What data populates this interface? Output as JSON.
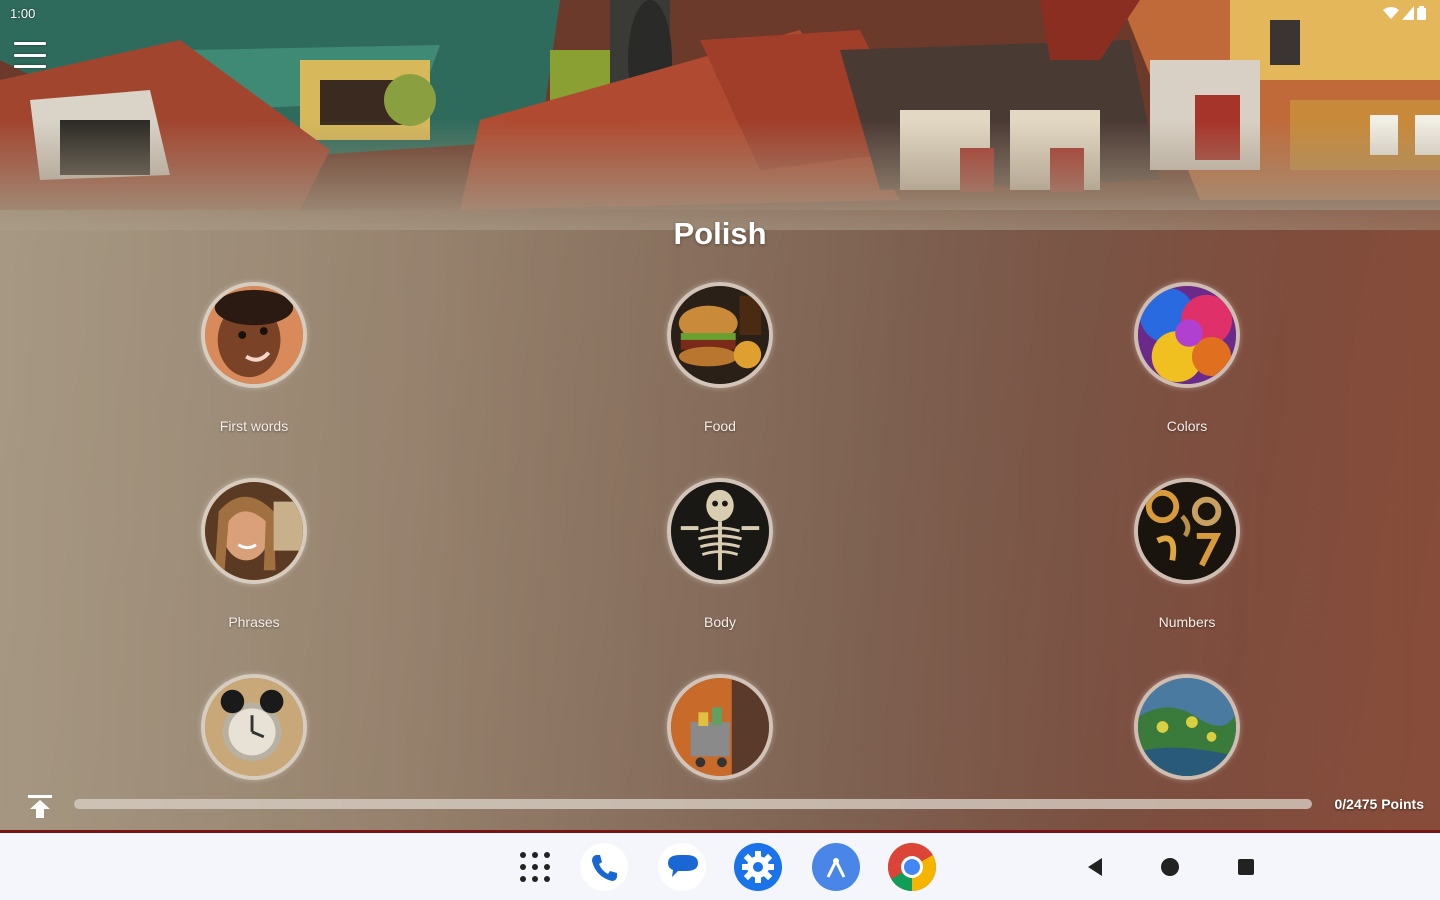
{
  "status_bar": {
    "time": "1:00"
  },
  "header": {
    "title": "Polish"
  },
  "categories": [
    {
      "label": "First words",
      "icon": "child-photo-icon"
    },
    {
      "label": "Food",
      "icon": "burger-photo-icon"
    },
    {
      "label": "Colors",
      "icon": "colors-photo-icon"
    },
    {
      "label": "Phrases",
      "icon": "woman-photo-icon"
    },
    {
      "label": "Body",
      "icon": "skeleton-photo-icon"
    },
    {
      "label": "Numbers",
      "icon": "numbers-photo-icon"
    },
    {
      "label": "",
      "icon": "alarm-clock-photo-icon"
    },
    {
      "label": "",
      "icon": "shopping-photo-icon"
    },
    {
      "label": "",
      "icon": "nature-photo-icon"
    }
  ],
  "progress": {
    "points_text": "0/2475 Points",
    "fraction": 0
  },
  "taskbar": {
    "apps": [
      "app-drawer-icon",
      "phone-icon",
      "messages-icon",
      "settings-icon",
      "files-icon",
      "chrome-icon"
    ],
    "nav": [
      "back-icon",
      "home-icon",
      "recents-icon"
    ]
  },
  "colors": {
    "accent": "#f0a020",
    "divider": "#7a1414",
    "taskbar_bg": "#f5f6fb"
  }
}
